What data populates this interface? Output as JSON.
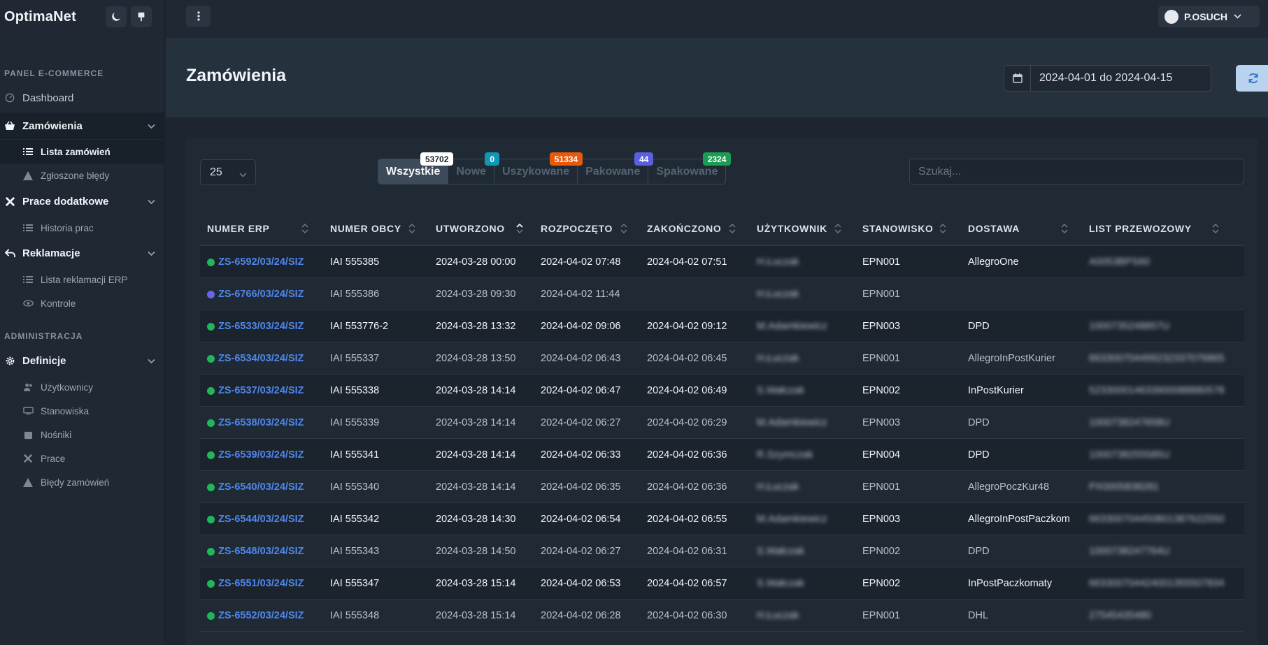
{
  "app": {
    "brand": "OptimaNet",
    "user": "P.OSUCH",
    "page_title": "Zamówienia"
  },
  "sidebar": {
    "sections": [
      {
        "title": "PANEL E-COMMERCE"
      },
      {
        "title": "ADMINISTRACJA"
      }
    ],
    "items": [
      {
        "label": "Dashboard",
        "icon": "gauge-icon"
      },
      {
        "label": "Zamówienia",
        "icon": "basket-icon"
      },
      {
        "label": "Lista zamówień",
        "icon": "list-icon"
      },
      {
        "label": "Zgłoszone błędy",
        "icon": "warning-icon"
      },
      {
        "label": "Prace dodatkowe",
        "icon": "tools-icon"
      },
      {
        "label": "Historia prac",
        "icon": "list-icon"
      },
      {
        "label": "Reklamacje",
        "icon": "return-icon"
      },
      {
        "label": "Lista reklamacji ERP",
        "icon": "list-icon"
      },
      {
        "label": "Kontrole",
        "icon": "eye-icon"
      },
      {
        "label": "Definicje",
        "icon": "gear-icon"
      },
      {
        "label": "Użytkownicy",
        "icon": "users-icon"
      },
      {
        "label": "Stanowiska",
        "icon": "monitor-icon"
      },
      {
        "label": "Nośniki",
        "icon": "box-icon"
      },
      {
        "label": "Prace",
        "icon": "tools-icon"
      },
      {
        "label": "Błędy zamówień",
        "icon": "warning-icon"
      }
    ]
  },
  "filters": {
    "date_range": "2024-04-01 do 2024-04-15",
    "per_page": "25",
    "search_placeholder": "Szukaj..."
  },
  "tabs": [
    {
      "label": "Wszystkie",
      "count": "53702",
      "color": "#ffffff"
    },
    {
      "label": "Nowe",
      "count": "0",
      "color": "#1296b7"
    },
    {
      "label": "Uszykowane",
      "count": "51334",
      "color": "#e8590c"
    },
    {
      "label": "Pakowane",
      "count": "44",
      "color": "#5b5fe0"
    },
    {
      "label": "Spakowane",
      "count": "2324",
      "color": "#1c9d55"
    }
  ],
  "table": {
    "columns": [
      "NUMER ERP",
      "NUMER OBCY",
      "UTWORZONO",
      "ROZPOCZĘTO",
      "ZAKOŃCZONO",
      "UŻYTKOWNIK",
      "STANOWISKO",
      "DOSTAWA",
      "LIST PRZEWOZOWY"
    ],
    "rows": [
      {
        "erp": "ZS-6592/03/24/SIZ",
        "status": "#22b55a",
        "obcy": "IAI 555385",
        "utw": "2024-03-28 00:00",
        "roz": "2024-04-02 07:48",
        "zak": "2024-04-02 07:51",
        "uz": "H.Łuczak",
        "st": "EPN001",
        "dost": "AllegroOne",
        "list": "A0053BPS60"
      },
      {
        "erp": "ZS-6766/03/24/SIZ",
        "status": "#6b63e8",
        "obcy": "IAI 555386",
        "utw": "2024-03-28 09:30",
        "roz": "2024-04-02 11:44",
        "zak": "",
        "uz": "H.Łuczak",
        "st": "EPN001",
        "dost": "",
        "list": ""
      },
      {
        "erp": "ZS-6533/03/24/SIZ",
        "status": "#22b55a",
        "obcy": "IAI 553776-2",
        "utw": "2024-03-28 13:32",
        "roz": "2024-04-02 09:06",
        "zak": "2024-04-02 09:12",
        "uz": "M.Adamkiewicz",
        "st": "EPN003",
        "dost": "DPD",
        "list": "1000735248857U"
      },
      {
        "erp": "ZS-6534/03/24/SIZ",
        "status": "#22b55a",
        "obcy": "IAI 555337",
        "utw": "2024-03-28 13:50",
        "roz": "2024-04-02 06:43",
        "zak": "2024-04-02 06:45",
        "uz": "H.Łuczak",
        "st": "EPN001",
        "dost": "AllegroInPostKurier",
        "list": "663300704499232337076865"
      },
      {
        "erp": "ZS-6537/03/24/SIZ",
        "status": "#22b55a",
        "obcy": "IAI 555338",
        "utw": "2024-03-28 14:14",
        "roz": "2024-04-02 06:47",
        "zak": "2024-04-02 06:49",
        "uz": "S.Wałczak",
        "st": "EPN002",
        "dost": "InPostKurier",
        "list": "523300014633900088880578"
      },
      {
        "erp": "ZS-6538/03/24/SIZ",
        "status": "#22b55a",
        "obcy": "IAI 555339",
        "utw": "2024-03-28 14:14",
        "roz": "2024-04-02 06:27",
        "zak": "2024-04-02 06:29",
        "uz": "M.Adamkiewicz",
        "st": "EPN003",
        "dost": "DPD",
        "list": "1000738247658U"
      },
      {
        "erp": "ZS-6539/03/24/SIZ",
        "status": "#22b55a",
        "obcy": "IAI 555341",
        "utw": "2024-03-28 14:14",
        "roz": "2024-04-02 06:33",
        "zak": "2024-04-02 06:36",
        "uz": "R.Szymczak",
        "st": "EPN004",
        "dost": "DPD",
        "list": "1000738255585U"
      },
      {
        "erp": "ZS-6540/03/24/SIZ",
        "status": "#22b55a",
        "obcy": "IAI 555340",
        "utw": "2024-03-28 14:14",
        "roz": "2024-04-02 06:35",
        "zak": "2024-04-02 06:36",
        "uz": "H.Łuczak",
        "st": "EPN001",
        "dost": "AllegroPoczKur48",
        "list": "PX0005838281"
      },
      {
        "erp": "ZS-6544/03/24/SIZ",
        "status": "#22b55a",
        "obcy": "IAI 555342",
        "utw": "2024-03-28 14:30",
        "roz": "2024-04-02 06:54",
        "zak": "2024-04-02 06:55",
        "uz": "M.Adamkiewicz",
        "st": "EPN003",
        "dost": "AllegroInPostPaczkom",
        "list": "663300704450801387622550"
      },
      {
        "erp": "ZS-6548/03/24/SIZ",
        "status": "#22b55a",
        "obcy": "IAI 555343",
        "utw": "2024-03-28 14:50",
        "roz": "2024-04-02 06:27",
        "zak": "2024-04-02 06:31",
        "uz": "S.Wałczak",
        "st": "EPN002",
        "dost": "DPD",
        "list": "1000738247764U"
      },
      {
        "erp": "ZS-6551/03/24/SIZ",
        "status": "#22b55a",
        "obcy": "IAI 555347",
        "utw": "2024-03-28 15:14",
        "roz": "2024-04-02 06:53",
        "zak": "2024-04-02 06:57",
        "uz": "S.Wałczak",
        "st": "EPN002",
        "dost": "InPostPaczkomaty",
        "list": "663300704424001355507834"
      },
      {
        "erp": "ZS-6552/03/24/SIZ",
        "status": "#22b55a",
        "obcy": "IAI 555348",
        "utw": "2024-03-28 15:14",
        "roz": "2024-04-02 06:28",
        "zak": "2024-04-02 06:30",
        "uz": "H.Łuczak",
        "st": "EPN001",
        "dost": "DHL",
        "list": "27545435480"
      }
    ]
  }
}
